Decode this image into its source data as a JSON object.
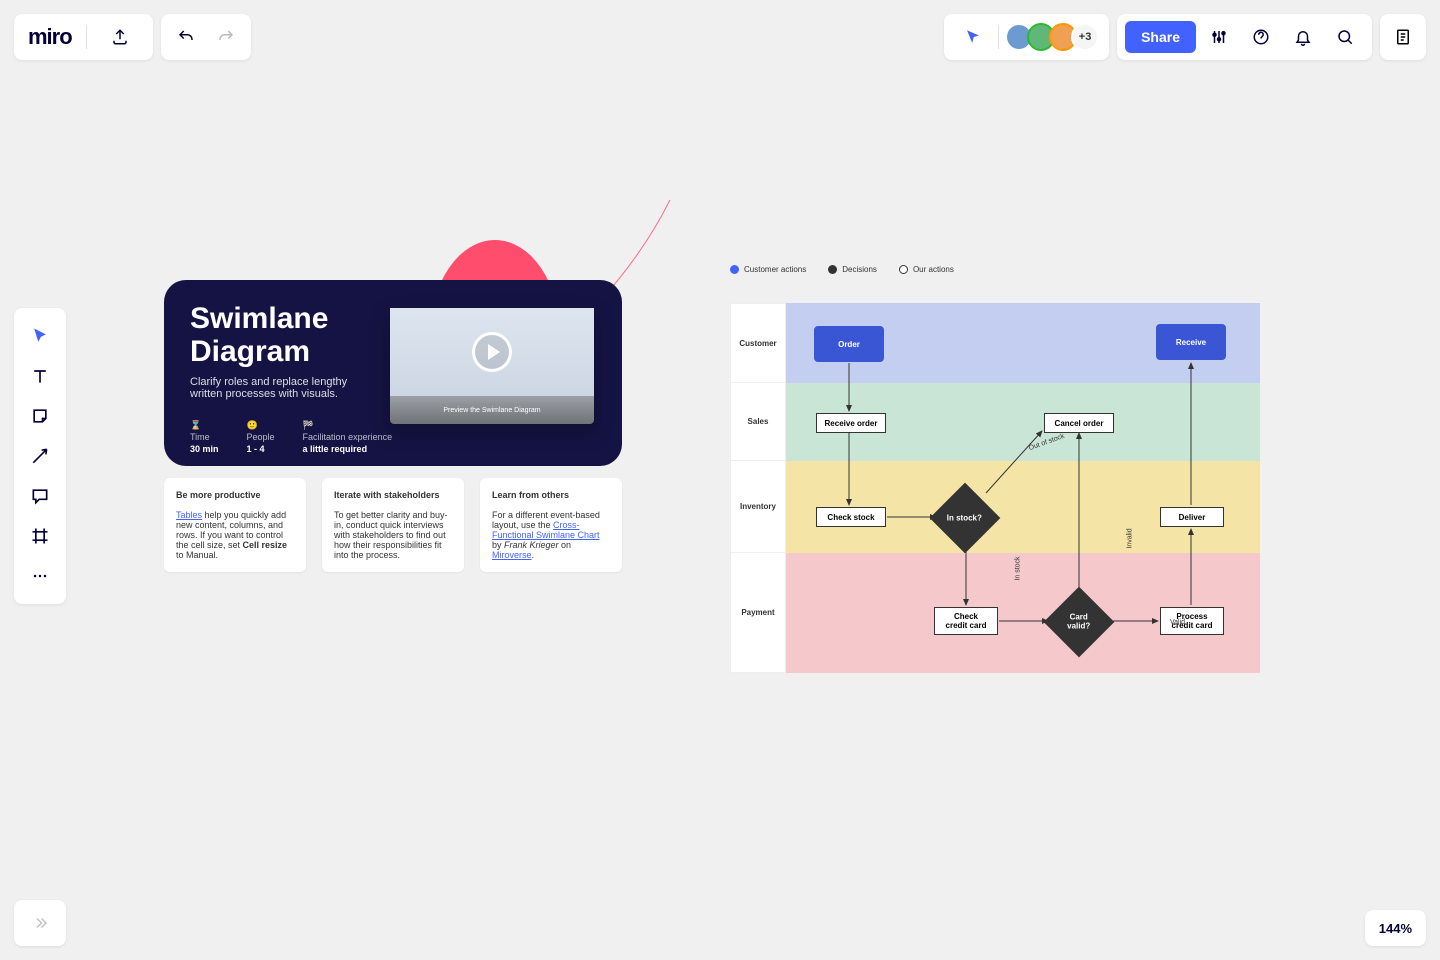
{
  "logo": "miro",
  "share_label": "Share",
  "more_collaborators": "+3",
  "zoom": "144%",
  "hero": {
    "title": "Swimlane\nDiagram",
    "subtitle": "Clarify roles and replace lengthy written processes with visuals.",
    "meta": [
      {
        "icon": "⌛",
        "label": "Time",
        "value": "30 min"
      },
      {
        "icon": "🙂",
        "label": "People",
        "value": "1 - 4"
      },
      {
        "icon": "🏁",
        "label": "Facilitation experience",
        "value": "a little required"
      }
    ],
    "thumb_caption": "Preview the Swimlane Diagram"
  },
  "info_cards": [
    {
      "title": "Be more productive",
      "html": "<a data-interactable='true' href='#'>Tables</a> help you quickly add new content, columns, and rows. If you want to control the cell size, set <strong>Cell resize</strong> to Manual."
    },
    {
      "title": "Iterate with stakeholders",
      "html": "To get better clarity and buy-in, conduct quick interviews with stakeholders to find out how their responsibilities fit into the process."
    },
    {
      "title": "Learn from others",
      "html": "For a different event-based layout, use the <a data-interactable='true' href='#'>Cross-Functional Swimlane Chart</a> by <em>Frank Krieger</em> on <a data-interactable='true' href='#'>Miroverse</a>."
    }
  ],
  "legend": [
    {
      "label": "Customer actions",
      "color": "#4262ff",
      "fill": true
    },
    {
      "label": "Decisions",
      "color": "#333",
      "fill": true
    },
    {
      "label": "Our actions",
      "color": "#333",
      "fill": false
    }
  ],
  "lanes": [
    "Customer",
    "Sales",
    "Inventory",
    "Payment"
  ],
  "nodes": {
    "order": "Order",
    "receive": "Receive",
    "receive_order": "Receive order",
    "cancel_order": "Cancel order",
    "check_stock": "Check stock",
    "in_stock": "In stock?",
    "deliver": "Deliver",
    "check_cc": "Check\ncredit card",
    "card_valid": "Card\nvalid?",
    "process_cc": "Process\ncredit card"
  },
  "edge_labels": {
    "out_of_stock": "Out of stock",
    "in_stock": "In stock",
    "invalid": "Invalid",
    "valid": "Valid"
  },
  "avatars": [
    {
      "bg": "#6b9bd1"
    },
    {
      "bg": "#5fb878",
      "ring": "#2eb82e"
    },
    {
      "bg": "#f0a050",
      "ring": "#ff9800"
    }
  ]
}
